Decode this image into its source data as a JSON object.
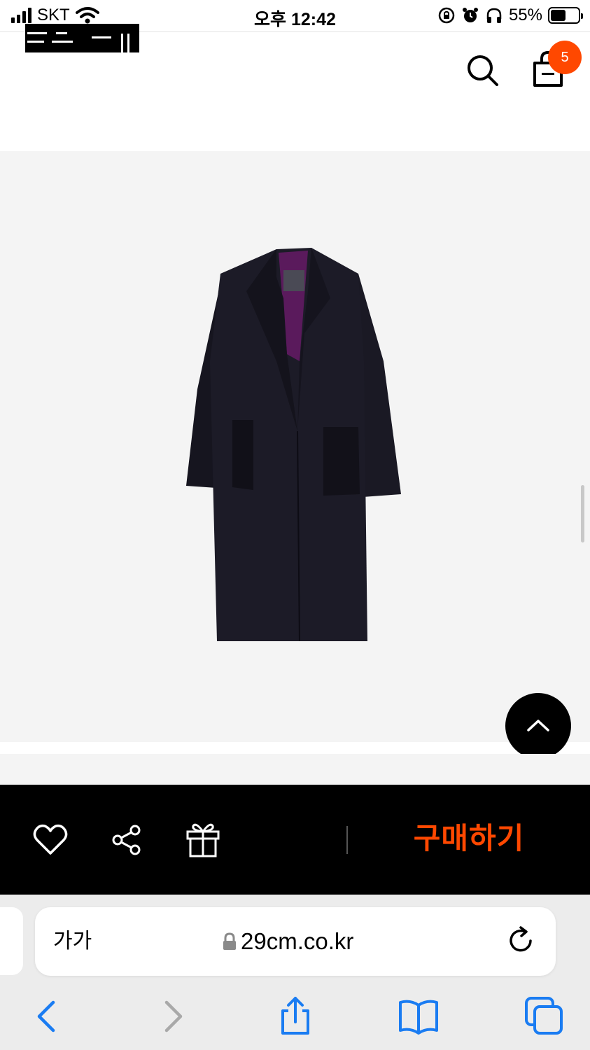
{
  "status_bar": {
    "carrier": "SKT",
    "time": "오후 12:42",
    "battery": "55%",
    "battery_level": 0.55,
    "icons": [
      "signal-icon",
      "wifi-icon",
      "rotation-lock-icon",
      "alarm-icon",
      "headphones-icon",
      "battery-icon"
    ]
  },
  "header": {
    "logo_icon": "29cm-logo-icon",
    "search_icon": "search-icon",
    "cart_icon": "shopping-bag-icon",
    "cart_count": "5",
    "badge_color": "#ff4800"
  },
  "product": {
    "image_icon": "coat-product-image",
    "scroll_top_icon": "chevron-up-icon",
    "background_color": "#f4f4f4"
  },
  "action_bar": {
    "like_icon": "heart-icon",
    "share_icon": "share-icon",
    "gift_icon": "gift-icon",
    "buy_label": "구매하기",
    "buy_color": "#ff4800"
  },
  "browser": {
    "text_size_label": "가가",
    "url": "29cm.co.kr",
    "lock_icon": "lock-icon",
    "reload_icon": "reload-icon",
    "toolbar_icons": [
      "back-icon",
      "forward-icon",
      "share-icon",
      "bookmarks-icon",
      "tabs-icon"
    ],
    "accent_color": "#1a7cf2"
  }
}
